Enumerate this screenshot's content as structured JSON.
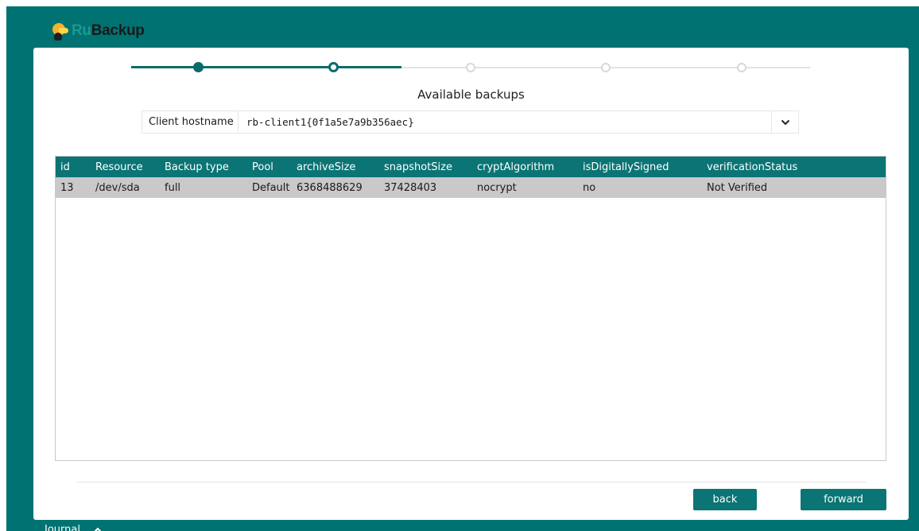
{
  "app": {
    "logo_ru": "Ru",
    "logo_backup": "Backup",
    "accent_color": "#007272"
  },
  "stepper": {
    "total_steps": 5,
    "current_step": 2
  },
  "page": {
    "title": "Available backups"
  },
  "client": {
    "label": "Client hostname",
    "selected_value": "rb-client1{0f1a5e7a9b356aec}"
  },
  "table": {
    "columns": [
      "id",
      "Resource",
      "Backup type",
      "Pool",
      "archiveSize",
      "snapshotSize",
      "cryptAlgorithm",
      "isDigitallySigned",
      "verificationStatus"
    ],
    "rows": [
      [
        "13",
        "/dev/sda",
        "full",
        "Default",
        "6368488629",
        "37428403",
        "nocrypt",
        "no",
        "Not Verified"
      ]
    ]
  },
  "buttons": {
    "back": "back",
    "forward": "forward"
  },
  "footer": {
    "journal": "Journal",
    "toggle_icon": "chevron-up-icon"
  }
}
